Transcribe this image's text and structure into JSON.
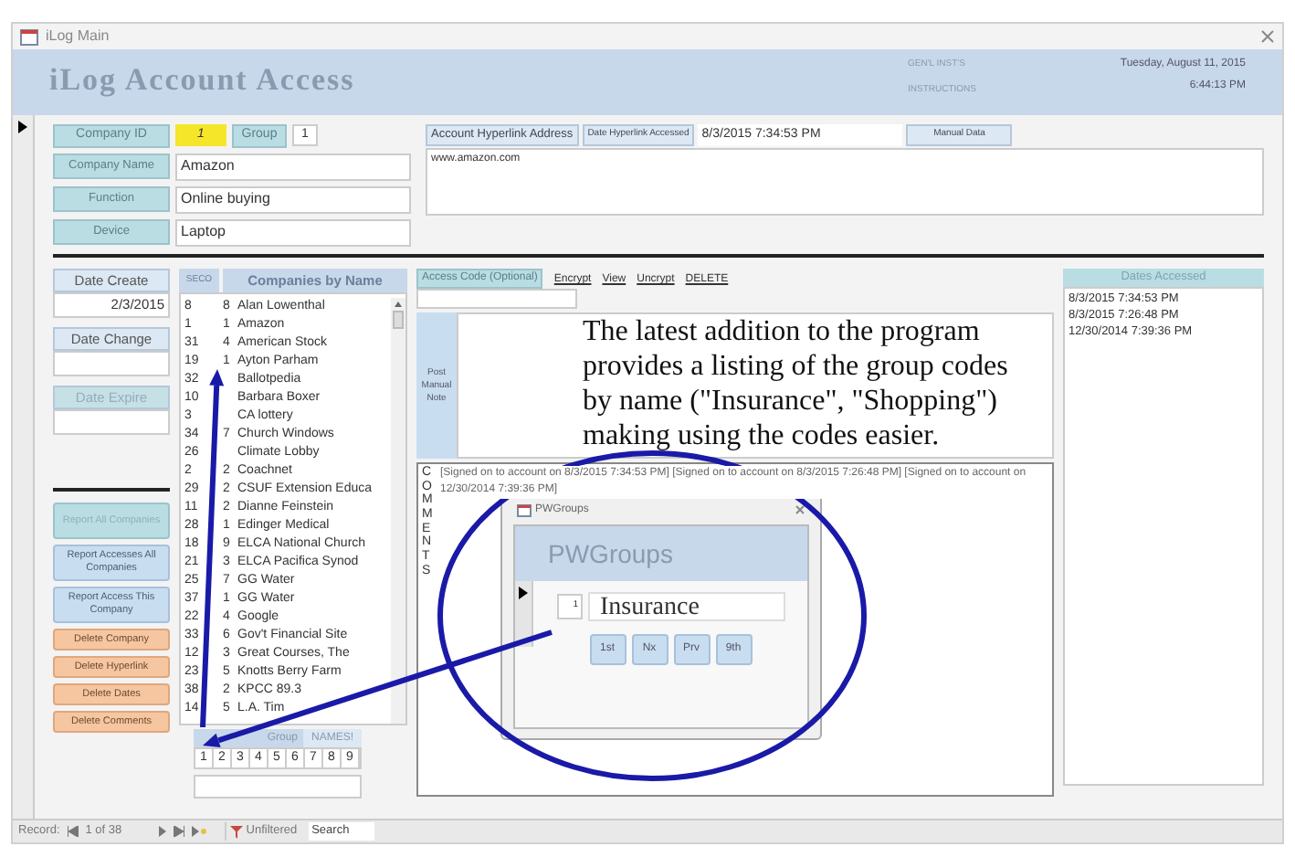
{
  "window": {
    "title": "iLog Main"
  },
  "header": {
    "title": "iLog Account Access",
    "instructions": [
      "GEN'L INST'S",
      "INSTRUCTIONS"
    ],
    "date": "Tuesday, August 11, 2015",
    "time": "6:44:13 PM"
  },
  "company": {
    "id_label": "Company ID",
    "id": "1",
    "group_label": "Group",
    "group": "1",
    "fields": [
      {
        "label": "Company Name",
        "value": "Amazon"
      },
      {
        "label": "Function",
        "value": "Online buying"
      },
      {
        "label": "Device",
        "value": "Laptop"
      }
    ]
  },
  "hyperlink": {
    "address_label": "Account Hyperlink Address",
    "accessed_label": "Date Hyperlink Accessed",
    "accessed": "8/3/2015 7:34:53 PM",
    "manual_button": "Manual Data",
    "address": "www.amazon.com"
  },
  "dates": [
    {
      "label": "Date Create",
      "value": "2/3/2015",
      "disabled": false
    },
    {
      "label": "Date Change",
      "disabled": false
    },
    {
      "label": "Date Expire",
      "disabled": true
    }
  ],
  "buttons": [
    {
      "label": "Report All Companies",
      "kind": "report",
      "disabled": true
    },
    {
      "label": "Report Accesses All Companies",
      "kind": "report",
      "disabled": false
    },
    {
      "label": "Report Access This Company",
      "kind": "report",
      "disabled": false
    },
    {
      "label": "Delete Company",
      "kind": "delete",
      "disabled": false
    },
    {
      "label": "Delete Hyperlink",
      "kind": "delete",
      "disabled": false
    },
    {
      "label": "Delete Dates",
      "kind": "delete",
      "disabled": false
    },
    {
      "label": "Delete Comments",
      "kind": "delete",
      "disabled": false
    }
  ],
  "company_list": {
    "columns": [
      "SECO",
      "Companies by Name"
    ],
    "rows": [
      {
        "id": "8",
        "group": "8",
        "name": "Alan Lowenthal"
      },
      {
        "id": "1",
        "group": "1",
        "name": "Amazon"
      },
      {
        "id": "31",
        "group": "4",
        "name": "American Stock"
      },
      {
        "id": "19",
        "group": "1",
        "name": "Ayton Parham"
      },
      {
        "id": "32",
        "name": "Ballotpedia"
      },
      {
        "id": "10",
        "name": "Barbara Boxer"
      },
      {
        "id": "3",
        "name": "CA lottery"
      },
      {
        "id": "34",
        "group": "7",
        "name": "Church Windows"
      },
      {
        "id": "26",
        "name": "Climate Lobby"
      },
      {
        "id": "2",
        "group": "2",
        "name": "Coachnet"
      },
      {
        "id": "29",
        "group": "2",
        "name": "CSUF Extension Educa"
      },
      {
        "id": "11",
        "group": "2",
        "name": "Dianne Feinstein"
      },
      {
        "id": "28",
        "group": "1",
        "name": "Edinger Medical"
      },
      {
        "id": "18",
        "group": "9",
        "name": "ELCA National Church"
      },
      {
        "id": "21",
        "group": "3",
        "name": "ELCA Pacifica Synod"
      },
      {
        "id": "25",
        "group": "7",
        "name": "GG Water"
      },
      {
        "id": "37",
        "group": "1",
        "name": "GG Water"
      },
      {
        "id": "22",
        "group": "4",
        "name": "Google"
      },
      {
        "id": "33",
        "group": "6",
        "name": "Gov't Financial Site"
      },
      {
        "id": "12",
        "group": "3",
        "name": "Great Courses, The"
      },
      {
        "id": "23",
        "group": "5",
        "name": "Knotts Berry Farm"
      },
      {
        "id": "38",
        "group": "2",
        "name": "KPCC 89.3"
      },
      {
        "id": "14",
        "group": "5",
        "name": "L.A. Tim"
      }
    ]
  },
  "group_names": {
    "labels": [
      "Group",
      "NAMES!"
    ],
    "digits": [
      "1",
      "2",
      "3",
      "4",
      "5",
      "6",
      "7",
      "8",
      "9"
    ]
  },
  "access_code": {
    "label": "Access Code (Optional)",
    "actions": [
      "Encrypt",
      "View",
      "Uncrypt",
      "DELETE"
    ]
  },
  "note": {
    "button": "Post Manual Note"
  },
  "comments": {
    "label": "COMMENTS",
    "text": "[Signed on to account on 8/3/2015 7:34:53 PM] [Signed on to account on 8/3/2015 7:26:48 PM] [Signed on to account on 12/30/2014 7:39:36 PM]"
  },
  "dates_accessed": {
    "label": "Dates Accessed",
    "items": [
      "8/3/2015 7:34:53 PM",
      "8/3/2015 7:26:48 PM",
      "12/30/2014 7:39:36 PM"
    ]
  },
  "popup": {
    "title": "PWGroups",
    "heading": "PWGroups",
    "number": "1",
    "name": "Insurance",
    "buttons": [
      "1st",
      "Nx",
      "Prv",
      "9th"
    ]
  },
  "annotation": [
    "The latest addition to the program",
    "provides a listing of the group codes",
    "by name (\"Insurance\", \"Shopping\")",
    "making using the codes easier."
  ],
  "status_bar": {
    "record_label": "Record:",
    "record": "1 of 38",
    "filter": "Unfiltered",
    "search": "Search"
  }
}
